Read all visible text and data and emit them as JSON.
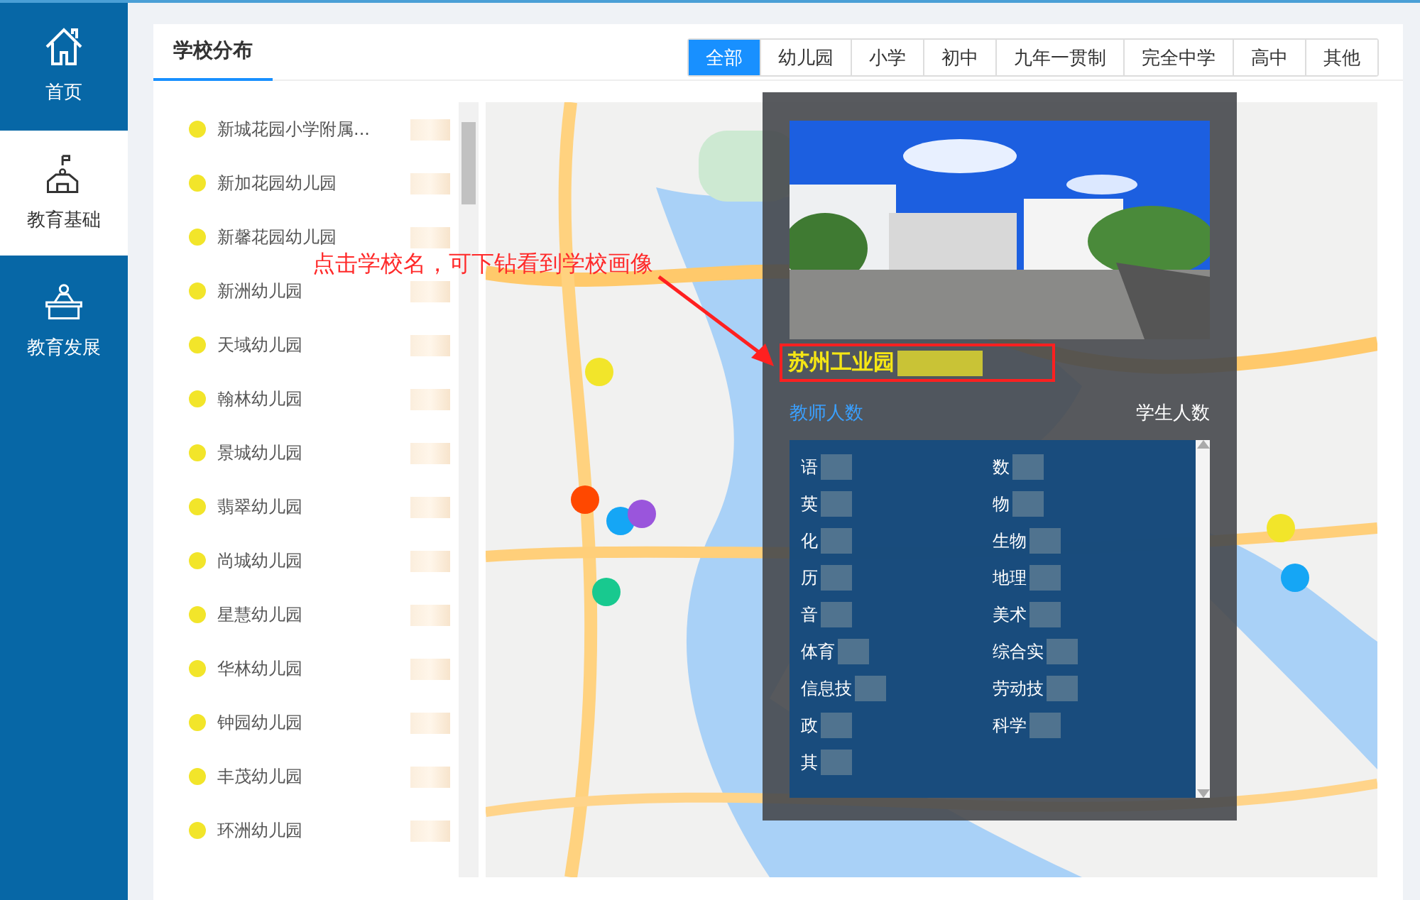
{
  "sidebar": {
    "items": [
      {
        "label": "首页",
        "kind": "home",
        "selected": false
      },
      {
        "label": "教育基础",
        "kind": "school",
        "selected": true
      },
      {
        "label": "教育发展",
        "kind": "podium",
        "selected": false
      }
    ]
  },
  "panel": {
    "title": "学校分布"
  },
  "filters": [
    {
      "label": "全部",
      "selected": true
    },
    {
      "label": "幼儿园",
      "selected": false
    },
    {
      "label": "小学",
      "selected": false
    },
    {
      "label": "初中",
      "selected": false
    },
    {
      "label": "九年一贯制",
      "selected": false
    },
    {
      "label": "完全中学",
      "selected": false
    },
    {
      "label": "高中",
      "selected": false
    },
    {
      "label": "其他",
      "selected": false
    }
  ],
  "schools": [
    {
      "name": "新城花园小学附属...",
      "color": "#f2e52a"
    },
    {
      "name": "新加花园幼儿园",
      "color": "#f2e52a"
    },
    {
      "name": "新馨花园幼儿园",
      "color": "#f2e52a"
    },
    {
      "name": "新洲幼儿园",
      "color": "#f2e52a"
    },
    {
      "name": "天域幼儿园",
      "color": "#f2e52a"
    },
    {
      "name": "翰林幼儿园",
      "color": "#f2e52a"
    },
    {
      "name": "景城幼儿园",
      "color": "#f2e52a"
    },
    {
      "name": "翡翠幼儿园",
      "color": "#f2e52a"
    },
    {
      "name": "尚城幼儿园",
      "color": "#f2e52a"
    },
    {
      "name": "星慧幼儿园",
      "color": "#f2e52a"
    },
    {
      "name": "华林幼儿园",
      "color": "#f2e52a"
    },
    {
      "name": "钟园幼儿园",
      "color": "#f2e52a"
    },
    {
      "name": "丰茂幼儿园",
      "color": "#f2e52a"
    },
    {
      "name": "环洲幼儿园",
      "color": "#f2e52a"
    }
  ],
  "annotation": {
    "text": "点击学校名，可下钻看到学校画像"
  },
  "popup": {
    "school_name": "苏州工业园",
    "teacher_label": "教师人数",
    "student_label": "学生人数",
    "subjects": [
      "语",
      "数",
      "英",
      "物",
      "化",
      "生物",
      "历",
      "地理",
      "音",
      "美术",
      "体育",
      "综合实",
      "信息技",
      "劳动技",
      "政",
      "科学",
      "其"
    ]
  }
}
